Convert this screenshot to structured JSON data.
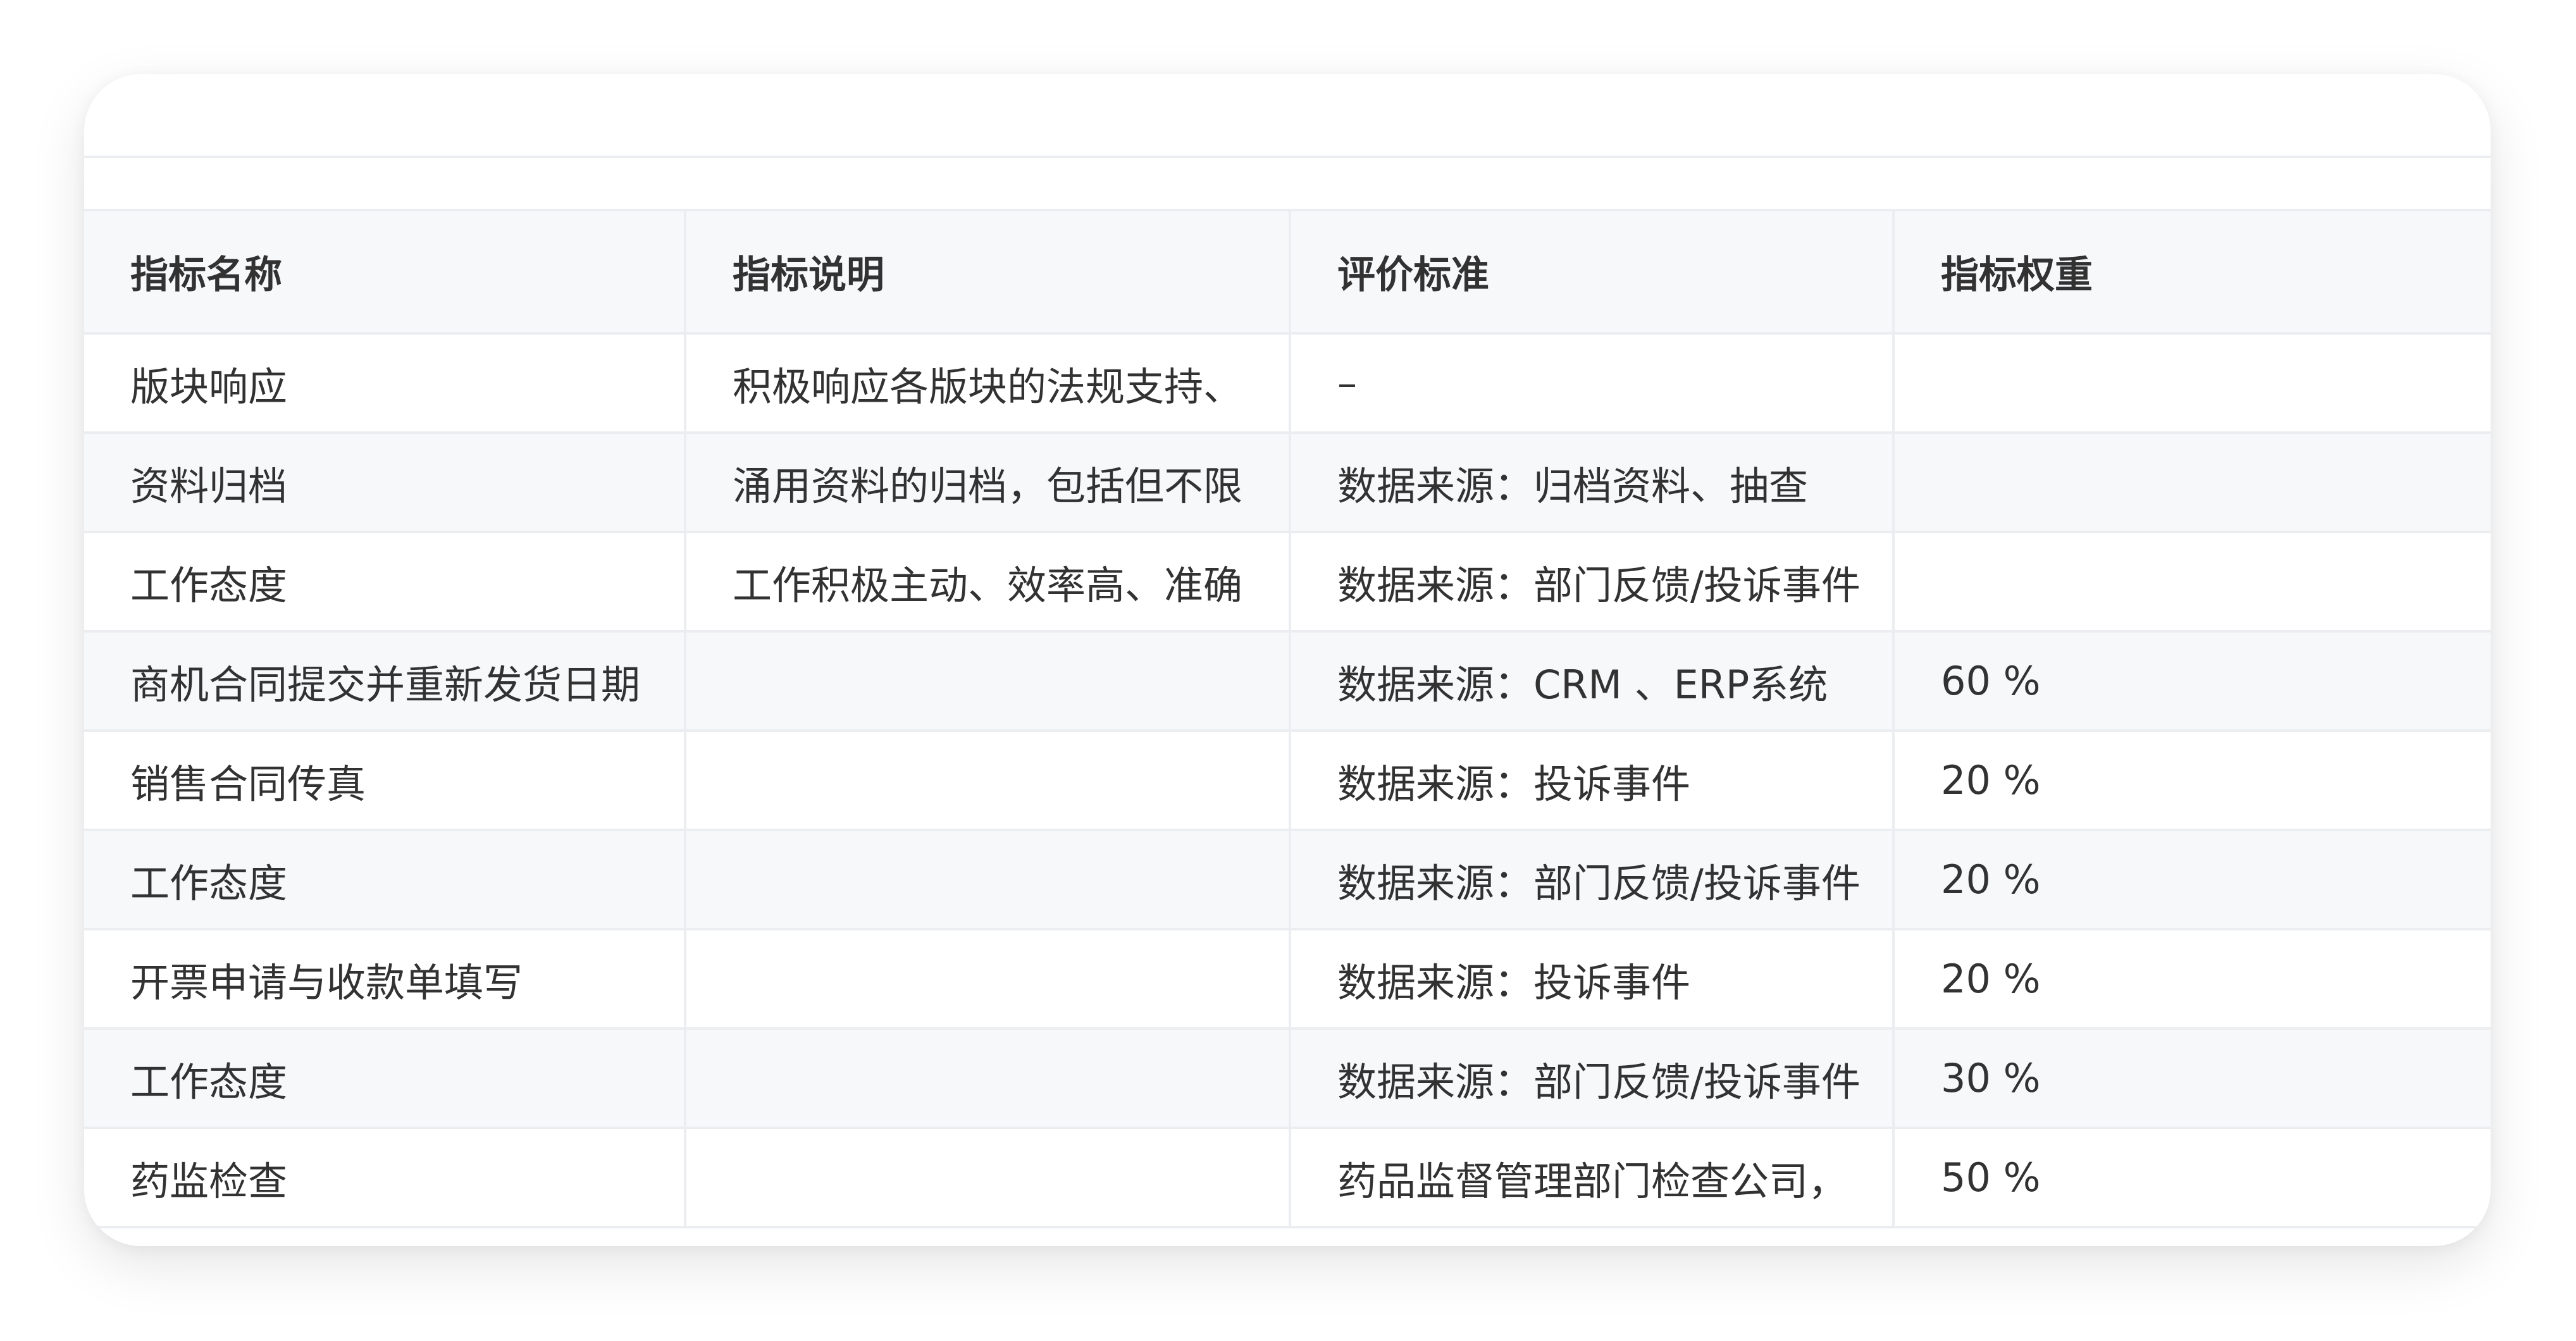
{
  "table": {
    "headers": [
      "指标名称",
      "指标说明",
      "评价标准",
      "指标权重"
    ],
    "rows": [
      [
        "版块响应",
        "积极响应各版块的法规支持、",
        "–",
        ""
      ],
      [
        "资料归档",
        "涌用资料的归档，包括但不限",
        "数据来源：归档资料、抽查",
        ""
      ],
      [
        "工作态度",
        "工作积极主动、效率高、准确",
        "数据来源：部门反馈/投诉事件",
        ""
      ],
      [
        "商机合同提交并重新发货日期",
        "",
        "数据来源：CRM 、ERP系统",
        "60 %"
      ],
      [
        "销售合同传真",
        "",
        "数据来源：投诉事件",
        "20 %"
      ],
      [
        "工作态度",
        "",
        "数据来源：部门反馈/投诉事件",
        "20 %"
      ],
      [
        "开票申请与收款单填写",
        "",
        "数据来源：投诉事件",
        "20 %"
      ],
      [
        "工作态度",
        "",
        "数据来源：部门反馈/投诉事件",
        "30 %"
      ],
      [
        "药监检查",
        "",
        "药品监督管理部门检查公司，",
        "50 %"
      ]
    ]
  }
}
